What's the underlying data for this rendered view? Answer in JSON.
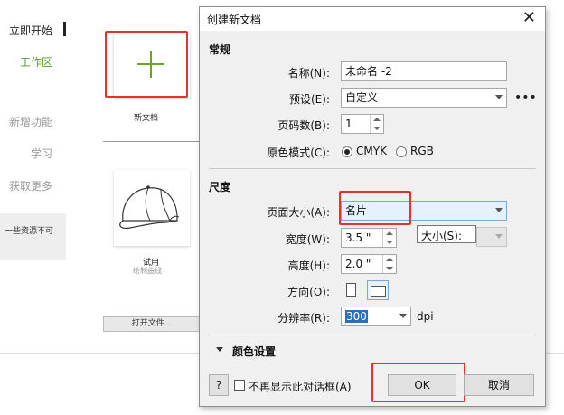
{
  "left_nav": {
    "items": [
      {
        "label": "立即开始"
      },
      {
        "label": "工作区"
      },
      {
        "label": "新增功能"
      },
      {
        "label": "学习"
      },
      {
        "label": "获取更多"
      }
    ],
    "note": "一些资源不可"
  },
  "workspace": {
    "new_doc_label": "新文档",
    "template_title": "试用",
    "template_subtitle": "绘制曲线",
    "open_file_label": "打开文件..."
  },
  "dialog": {
    "title": "创建新文档",
    "general_section": "常规",
    "name_label": "名称(N):",
    "name_value": "未命名 -2",
    "preset_label": "预设(E):",
    "preset_value": "自定义",
    "more_label": "•••",
    "pages_label": "页码数(B):",
    "pages_value": "1",
    "color_mode_label": "原色模式(C):",
    "color_modes": [
      "CMYK",
      "RGB"
    ],
    "color_mode_selected": "CMYK",
    "dimensions_section": "尺度",
    "page_size_label": "页面大小(A):",
    "page_size_value": "名片",
    "width_label": "宽度(W):",
    "width_value": "3.5 \"",
    "tooltip": "大小(S):",
    "height_label": "高度(H):",
    "height_value": "2.0 \"",
    "orientation_label": "方向(O):",
    "resolution_label": "分辨率(R):",
    "resolution_value": "300",
    "resolution_unit": "dpi",
    "color_settings_section": "颜色设置",
    "help_label": "?",
    "dont_show_label": "不再显示此对话框(A)",
    "ok_label": "OK",
    "cancel_label": "取消"
  },
  "colors": {
    "accent_green": "#6aa52d",
    "highlight_red": "#e2342d",
    "page_size_bg": "#e5f1fb"
  }
}
